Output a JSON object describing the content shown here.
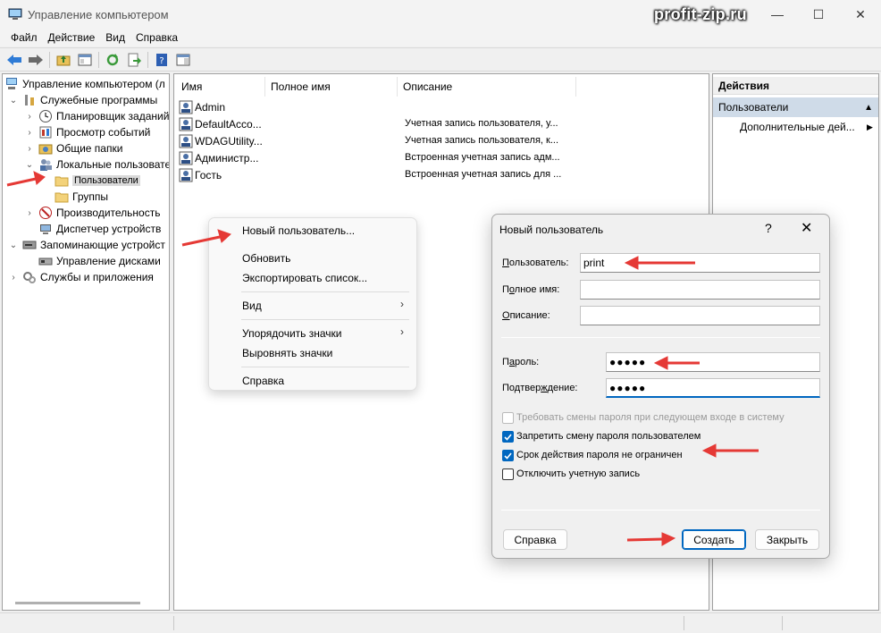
{
  "window": {
    "title": "Управление компьютером",
    "watermark": "profit-zip.ru",
    "minimize": "—",
    "maximize": "☐",
    "close": "✕"
  },
  "menu": [
    "Файл",
    "Действие",
    "Вид",
    "Справка"
  ],
  "tree": {
    "items": [
      {
        "label": "Управление компьютером (л",
        "expander": "",
        "icon": "computer-icon"
      },
      {
        "label": "Служебные программы",
        "expander": "⌄",
        "icon": "tools-icon"
      },
      {
        "label": "Планировщик заданий",
        "expander": "›",
        "icon": "clock-icon"
      },
      {
        "label": "Просмотр событий",
        "expander": "›",
        "icon": "event-viewer-icon"
      },
      {
        "label": "Общие папки",
        "expander": "›",
        "icon": "shared-folder-icon"
      },
      {
        "label": "Локальные пользовате",
        "expander": "⌄",
        "icon": "users-icon"
      },
      {
        "label": "Пользователи",
        "expander": "",
        "icon": "folder-icon"
      },
      {
        "label": "Группы",
        "expander": "",
        "icon": "folder-icon"
      },
      {
        "label": "Производительность",
        "expander": "›",
        "icon": "performance-icon"
      },
      {
        "label": "Диспетчер устройств",
        "expander": "",
        "icon": "device-manager-icon"
      },
      {
        "label": "Запоминающие устройст",
        "expander": "⌄",
        "icon": "storage-icon"
      },
      {
        "label": "Управление дисками",
        "expander": "",
        "icon": "disk-icon"
      },
      {
        "label": "Службы и приложения",
        "expander": "›",
        "icon": "services-icon"
      }
    ]
  },
  "list": {
    "columns": [
      "Имя",
      "Полное имя",
      "Описание"
    ],
    "rows": [
      {
        "name": "Admin",
        "fullname": "",
        "desc": ""
      },
      {
        "name": "DefaultAcco...",
        "fullname": "",
        "desc": "Учетная запись пользователя, у..."
      },
      {
        "name": "WDAGUtility...",
        "fullname": "",
        "desc": "Учетная запись пользователя, к..."
      },
      {
        "name": "Администр...",
        "fullname": "",
        "desc": "Встроенная учетная запись адм..."
      },
      {
        "name": "Гость",
        "fullname": "",
        "desc": "Встроенная учетная запись для ..."
      }
    ]
  },
  "actions": {
    "header": "Действия",
    "section": "Пользователи",
    "section_arrow": "▲",
    "more": "Дополнительные дей...",
    "more_arrow": "▶"
  },
  "context_menu": {
    "new_user": "Новый пользователь...",
    "refresh": "Обновить",
    "export": "Экспортировать список...",
    "view": "Вид",
    "arrange": "Упорядочить значки",
    "align": "Выровнять значки",
    "help": "Справка",
    "submenu_arrow": "›"
  },
  "dialog": {
    "title": "Новый пользователь",
    "help_glyph": "?",
    "close_glyph": "✕",
    "user_label_pre": "",
    "user_label_u": "П",
    "user_label_post": "ользователь:",
    "user_value": "print",
    "fullname_label_pre": "П",
    "fullname_label_u": "о",
    "fullname_label_post": "лное имя:",
    "fullname_value": "",
    "desc_label_pre": "",
    "desc_label_u": "О",
    "desc_label_post": "писание:",
    "desc_value": "",
    "password_label_pre": "П",
    "password_label_u": "а",
    "password_label_post": "роль:",
    "password_value": "●●●●●",
    "confirm_label_pre": "Подтвер",
    "confirm_label_u": "ж",
    "confirm_label_post": "дение:",
    "confirm_value": "●●●●●",
    "chk_change": "Требовать смены пароля при следующем входе в систему",
    "chk_forbid": "Запретить смену пароля пользователем",
    "chk_never": "Срок действия пароля не ограничен",
    "chk_disable": "Отключить учетную запись",
    "chk_change_checked": false,
    "chk_forbid_checked": true,
    "chk_never_checked": true,
    "chk_disable_checked": false,
    "btn_help": "Справка",
    "btn_create": "Создать",
    "btn_close": "Закрыть"
  },
  "colors": {
    "accent": "#0067c0",
    "arrow": "#e53935",
    "selection": "#cfdbe8"
  }
}
